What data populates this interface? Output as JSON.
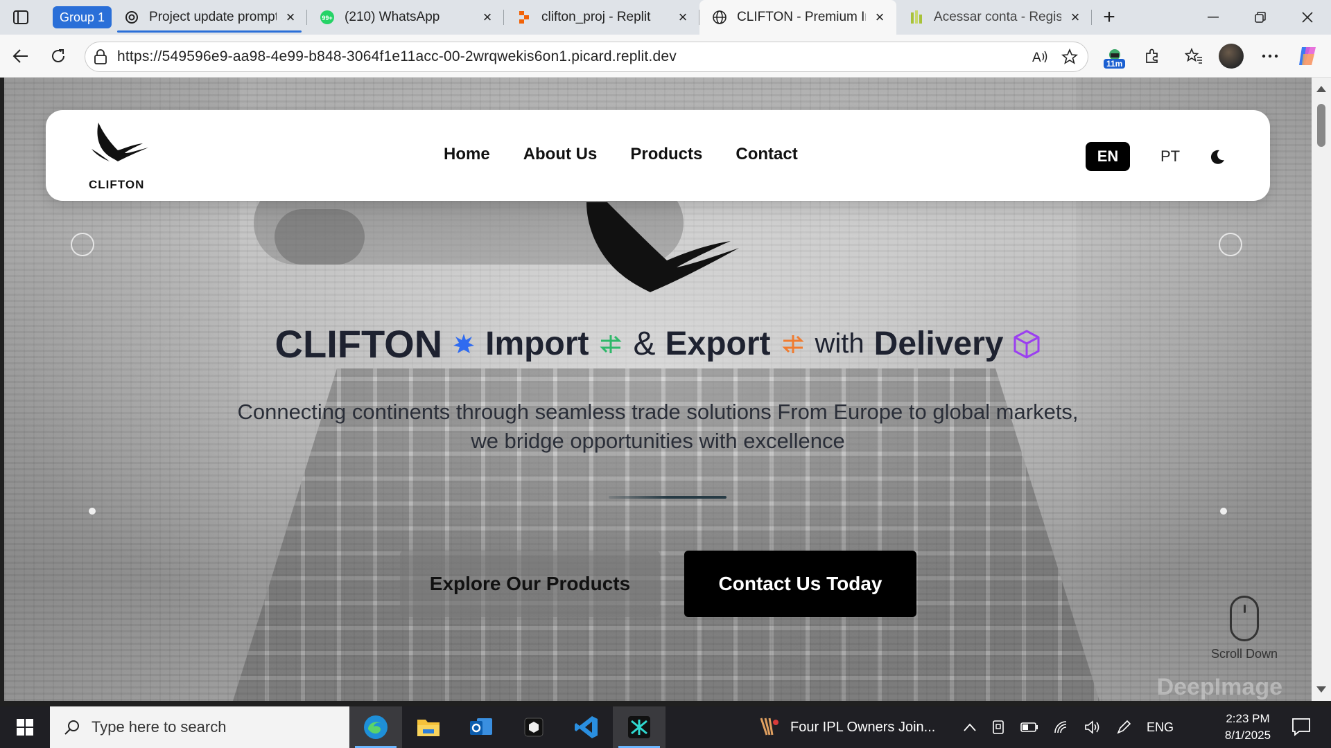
{
  "browser": {
    "tab_group_label": "Group 1",
    "tabs": [
      {
        "title": "Project update prompt",
        "icon": "chatgpt-icon",
        "grouped": true
      },
      {
        "title": "(210) WhatsApp",
        "icon": "whatsapp-icon",
        "badge": "99+"
      },
      {
        "title": "clifton_proj - Replit",
        "icon": "replit-icon"
      },
      {
        "title": "CLIFTON - Premium Imp",
        "icon": "globe-icon",
        "active": true
      },
      {
        "title": "Acessar conta - Registro",
        "icon": "registro-icon"
      }
    ],
    "url": "https://549596e9-aa98-4e99-b848-3064f1e11acc-00-2wrqwekis6on1.picard.replit.dev",
    "extension_badge": "11m"
  },
  "site": {
    "logo_text": "CLIFTON",
    "nav": [
      "Home",
      "About Us",
      "Products",
      "Contact"
    ],
    "languages": {
      "en": "EN",
      "pt": "PT",
      "selected": "EN"
    },
    "hero": {
      "brand": "CLIFTON",
      "word_import": "Import",
      "ampersand": "&",
      "word_export": "Export",
      "word_with": "with",
      "word_delivery": "Delivery",
      "subtitle_line1": "Connecting continents through seamless trade solutions From Europe to global markets,",
      "subtitle_line2": "we bridge opportunities with excellence",
      "primary_button": "Explore Our Products",
      "secondary_button": "Contact Us Today",
      "scroll_label": "Scroll Down",
      "watermark": "DeepImage"
    },
    "colors": {
      "star": "#2f6bf0",
      "import_icon": "#2fb86a",
      "export_icon": "#f07b2f",
      "delivery_icon": "#9b3ff0"
    }
  },
  "taskbar": {
    "search_placeholder": "Type here to search",
    "news_headline": "Four IPL Owners Join...",
    "language": "ENG",
    "time": "2:23 PM",
    "date": "8/1/2025"
  }
}
